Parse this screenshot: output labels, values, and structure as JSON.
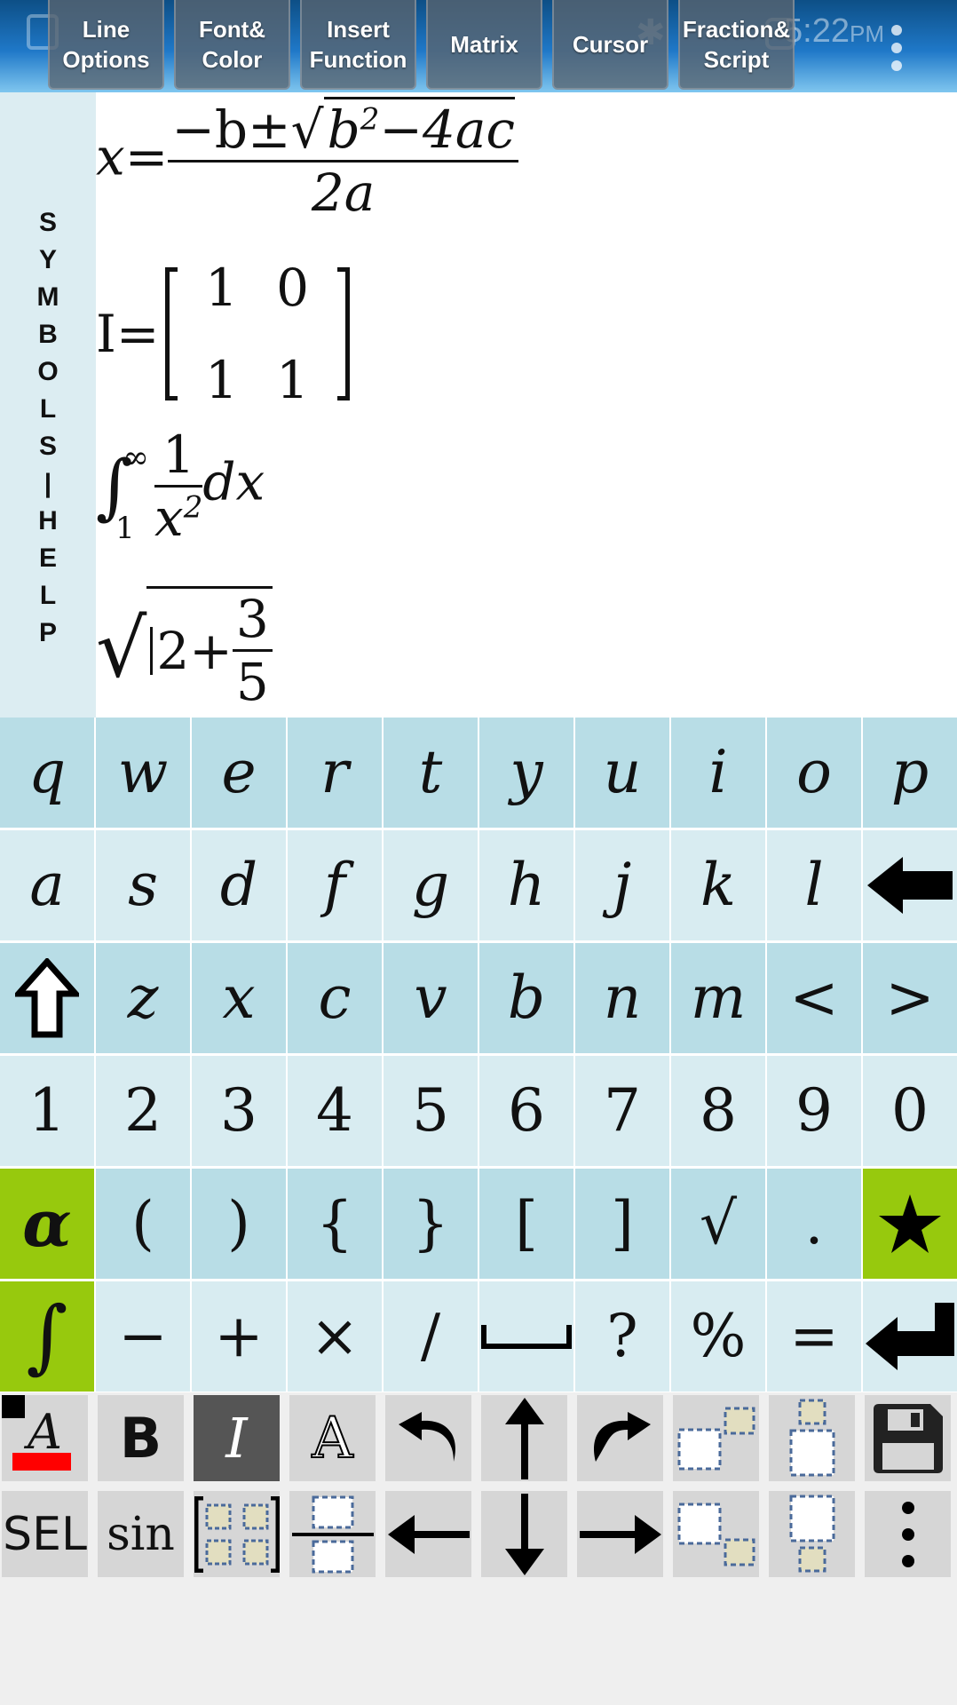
{
  "status_bar": {
    "time": "5:22",
    "ampm": "PM"
  },
  "menu_bar": {
    "buttons": [
      {
        "label": "Line\nOptions"
      },
      {
        "label": "Font&\nColor"
      },
      {
        "label": "Insert\nFunction"
      },
      {
        "label": "Matrix"
      },
      {
        "label": "Cursor"
      },
      {
        "label": "Fraction&\nScript"
      }
    ]
  },
  "side_tab": {
    "letters": [
      "S",
      "Y",
      "M",
      "B",
      "O",
      "L",
      "S",
      "|",
      "H",
      "E",
      "L",
      "P"
    ]
  },
  "equations": {
    "quadratic": {
      "lhs": "x=",
      "num_a": "−b±",
      "radicand": "b",
      "sup": "2",
      "radicand_b": "−4ac",
      "den": "2a"
    },
    "matrix": {
      "lhs": "I=",
      "cells": [
        "1",
        "0",
        "1",
        "1"
      ]
    },
    "integral": {
      "sign": "∫",
      "upper": "∞",
      "lower": "1",
      "num": "1",
      "den": "x",
      "den_sup": "2",
      "dx": "dx"
    },
    "sqrt": {
      "a": "2+",
      "num": "3",
      "den": "5"
    }
  },
  "keyboard": {
    "rows": [
      [
        "q",
        "w",
        "e",
        "r",
        "t",
        "y",
        "u",
        "i",
        "o",
        "p"
      ],
      [
        "a",
        "s",
        "d",
        "f",
        "g",
        "h",
        "j",
        "k",
        "l"
      ],
      [
        "z",
        "x",
        "c",
        "v",
        "b",
        "n",
        "m",
        "<",
        ">"
      ],
      [
        "1",
        "2",
        "3",
        "4",
        "5",
        "6",
        "7",
        "8",
        "9",
        "0"
      ],
      [
        "α",
        "(",
        ")",
        "{",
        "}",
        "[",
        "]",
        "√",
        "."
      ],
      [
        "∫",
        "−",
        "+",
        "×",
        "/",
        "?",
        "%",
        "="
      ]
    ],
    "icons": {
      "backspace": "backspace-arrow-icon",
      "shift": "shift-arrow-icon",
      "star": "star-icon",
      "space": "space-bar-icon",
      "enter": "enter-arrow-icon"
    },
    "accent_green": "#97c90d"
  },
  "toolbar": {
    "row1": [
      "A",
      "B",
      "I",
      "A"
    ],
    "row2_text": [
      "SEL",
      "sin"
    ]
  }
}
